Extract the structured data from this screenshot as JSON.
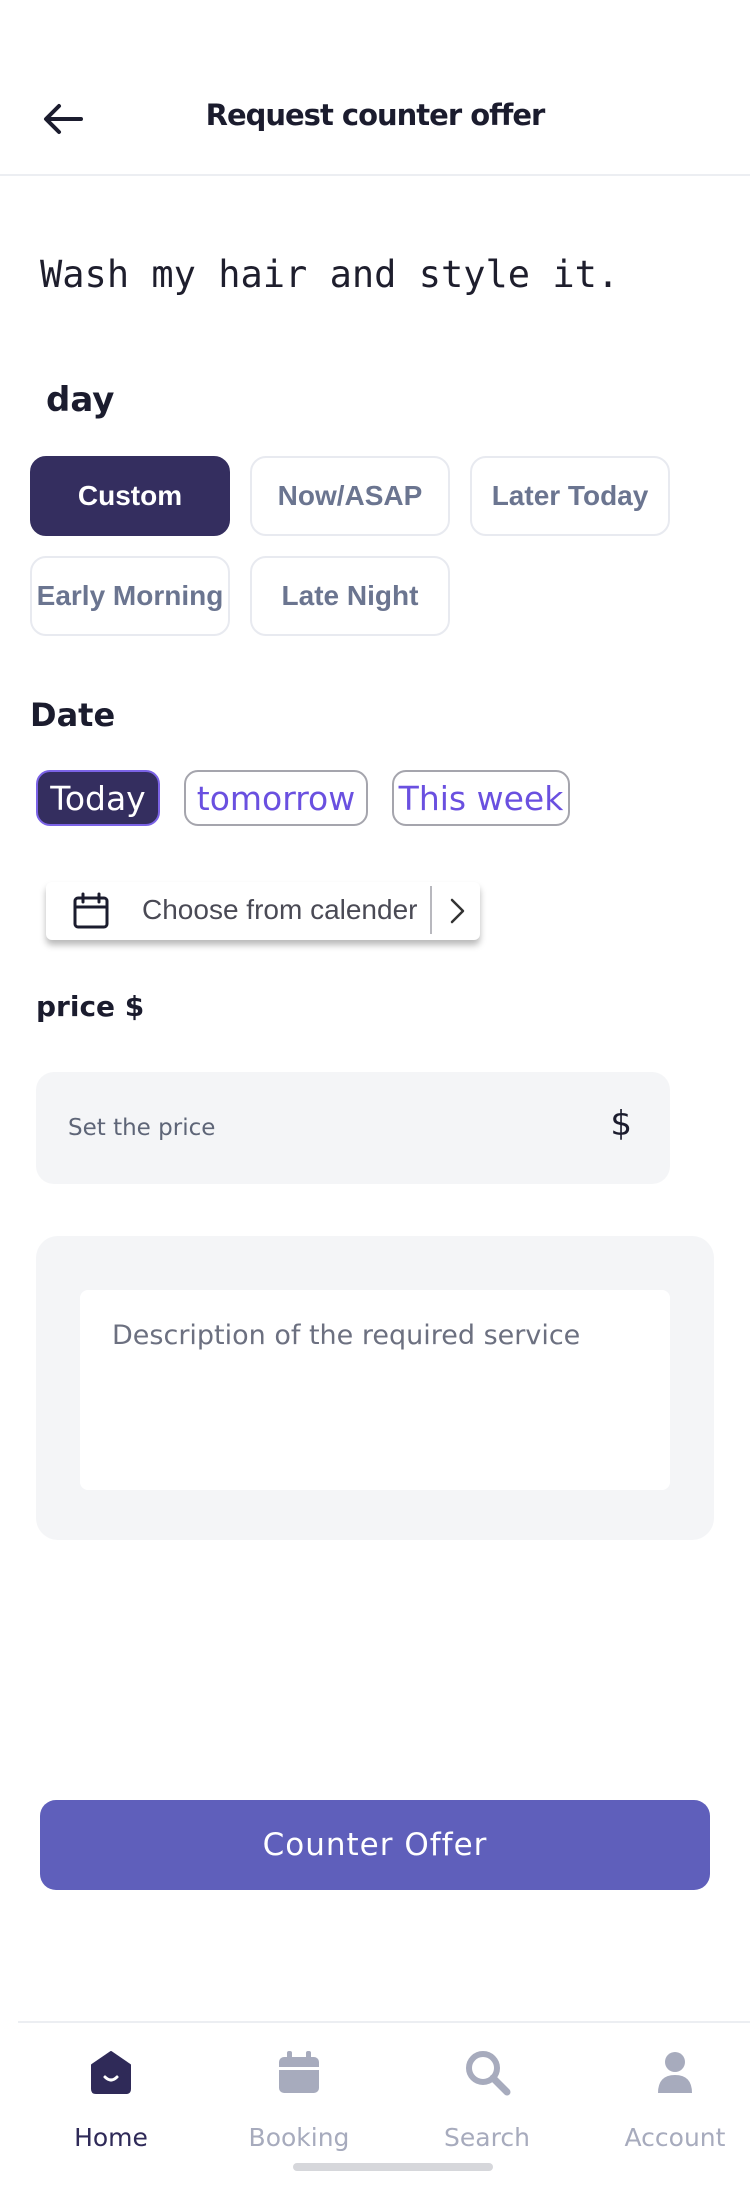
{
  "header": {
    "title": "Request counter offer"
  },
  "service": {
    "title": "Wash my hair and style it."
  },
  "day_section": {
    "label": "day",
    "options": [
      "Custom",
      "Now/ASAP",
      "Later Today",
      "Early Morning",
      "Late Night"
    ],
    "selected": "Custom"
  },
  "date_section": {
    "label": "Date",
    "options": [
      "Today",
      "tomorrow",
      "This week"
    ],
    "selected": "Today",
    "calendar_button": "Choose from calender"
  },
  "price": {
    "label": "price $",
    "placeholder": "Set the price",
    "value": "",
    "currency_symbol": "$"
  },
  "description": {
    "placeholder": "Description of the required service",
    "value": ""
  },
  "submit": {
    "label": "Counter Offer"
  },
  "tabbar": {
    "tabs": [
      {
        "label": "Home",
        "icon": "home-icon",
        "active": true
      },
      {
        "label": "Booking",
        "icon": "calendar-icon",
        "active": false
      },
      {
        "label": "Search",
        "icon": "search-icon",
        "active": false
      },
      {
        "label": "Account",
        "icon": "user-icon",
        "active": false
      }
    ]
  },
  "colors": {
    "primary_dark": "#342e5f",
    "button": "#5f5fbb",
    "accent_text": "#6a50e0",
    "field_bg": "#f4f5f7",
    "tab_inactive": "#a7abbd"
  }
}
